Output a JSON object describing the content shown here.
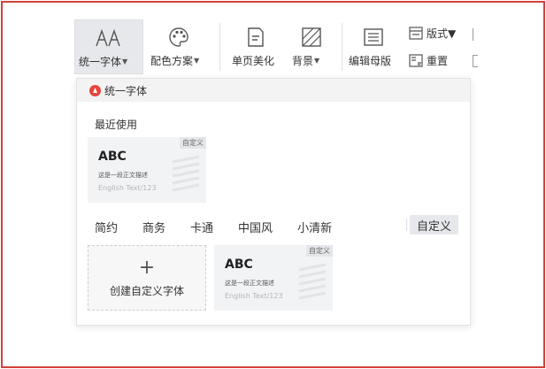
{
  "ribbon": {
    "unify_font": "统一字体",
    "color_scheme": "配色方案",
    "single_page": "单页美化",
    "background": "背景",
    "edit_master": "编辑母版",
    "layout": "版式",
    "reset": "重置"
  },
  "panel": {
    "title": "统一字体",
    "recent_label": "最近使用",
    "recent_card": {
      "badge": "自定义",
      "sample": "ABC",
      "description": "这是一段正文描述",
      "english": "English Text/123"
    },
    "categories": [
      "简约",
      "商务",
      "卡通",
      "中国风",
      "小清新"
    ],
    "selected_category": "自定义",
    "create_label": "创建自定义字体",
    "create_plus": "+",
    "custom_card": {
      "badge": "自定义",
      "sample": "ABC",
      "description": "这是一段正文描述",
      "english": "English Text/123"
    }
  },
  "colors": {
    "frame_border": "#d2403a",
    "logo": "#e8453c",
    "active_tool_bg": "#e6e8eb"
  }
}
